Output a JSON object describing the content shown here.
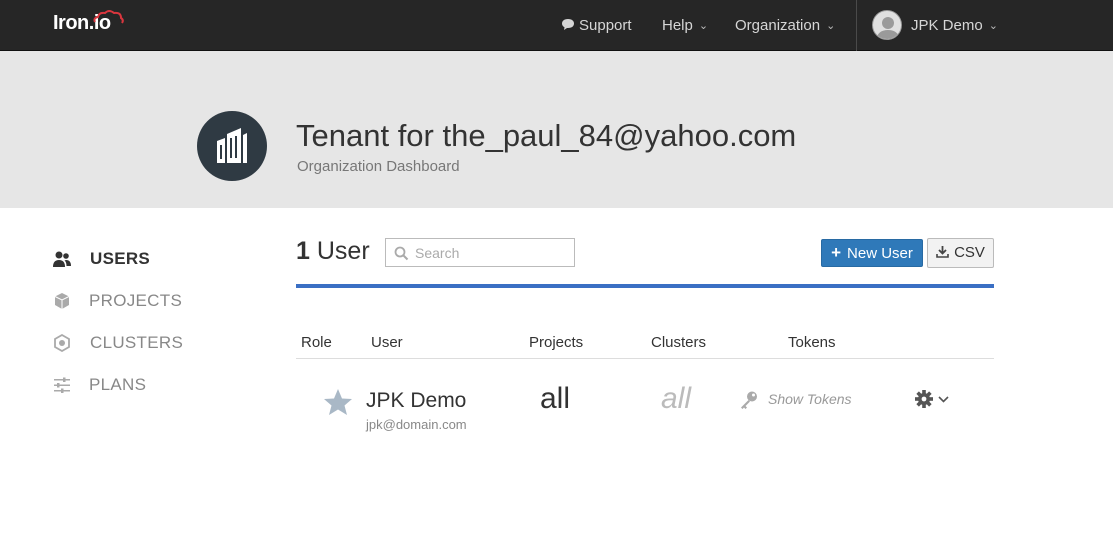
{
  "app": {
    "logo_text": "Iron.io"
  },
  "nav": {
    "support": "Support",
    "help": "Help",
    "organization": "Organization",
    "user": "JPK Demo"
  },
  "header": {
    "title": "Tenant for the_paul_84@yahoo.com",
    "subtitle": "Organization Dashboard"
  },
  "sidebar": {
    "items": [
      {
        "label": "USERS",
        "icon": "users-icon",
        "active": true
      },
      {
        "label": "PROJECTS",
        "icon": "cube-icon",
        "active": false
      },
      {
        "label": "CLUSTERS",
        "icon": "hexagon-icon",
        "active": false
      },
      {
        "label": "PLANS",
        "icon": "sliders-icon",
        "active": false
      }
    ]
  },
  "main": {
    "count_number": "1",
    "count_label": "User",
    "search_placeholder": "Search",
    "new_user_label": "New User",
    "csv_label": "CSV",
    "columns": [
      "Role",
      "User",
      "Projects",
      "Clusters",
      "Tokens"
    ],
    "rows": [
      {
        "role_icon": "star-icon",
        "name": "JPK Demo",
        "email": "jpk@domain.com",
        "projects": "all",
        "clusters": "all",
        "tokens_label": "Show Tokens"
      }
    ]
  },
  "colors": {
    "topbar": "#262626",
    "band": "#e6e6e6",
    "accent_blue": "#2f79b9",
    "rule_blue": "#3a6fc4"
  }
}
